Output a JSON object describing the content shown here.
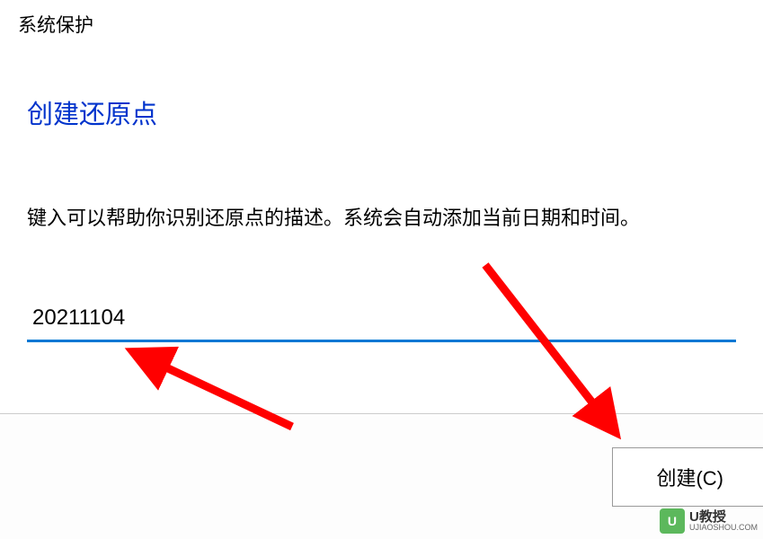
{
  "dialog": {
    "title": "系统保护",
    "heading": "创建还原点",
    "description": "键入可以帮助你识别还原点的描述。系统会自动添加当前日期和时间。",
    "input_value": "20211104",
    "create_button_label": "创建(C)"
  },
  "watermark": {
    "logo_letter": "U",
    "main_text": "U教授",
    "sub_text": "UJIAOSHOU.COM"
  },
  "colors": {
    "heading_color": "#0033cc",
    "input_border": "#0078d4",
    "arrow_color": "#ff0000"
  }
}
